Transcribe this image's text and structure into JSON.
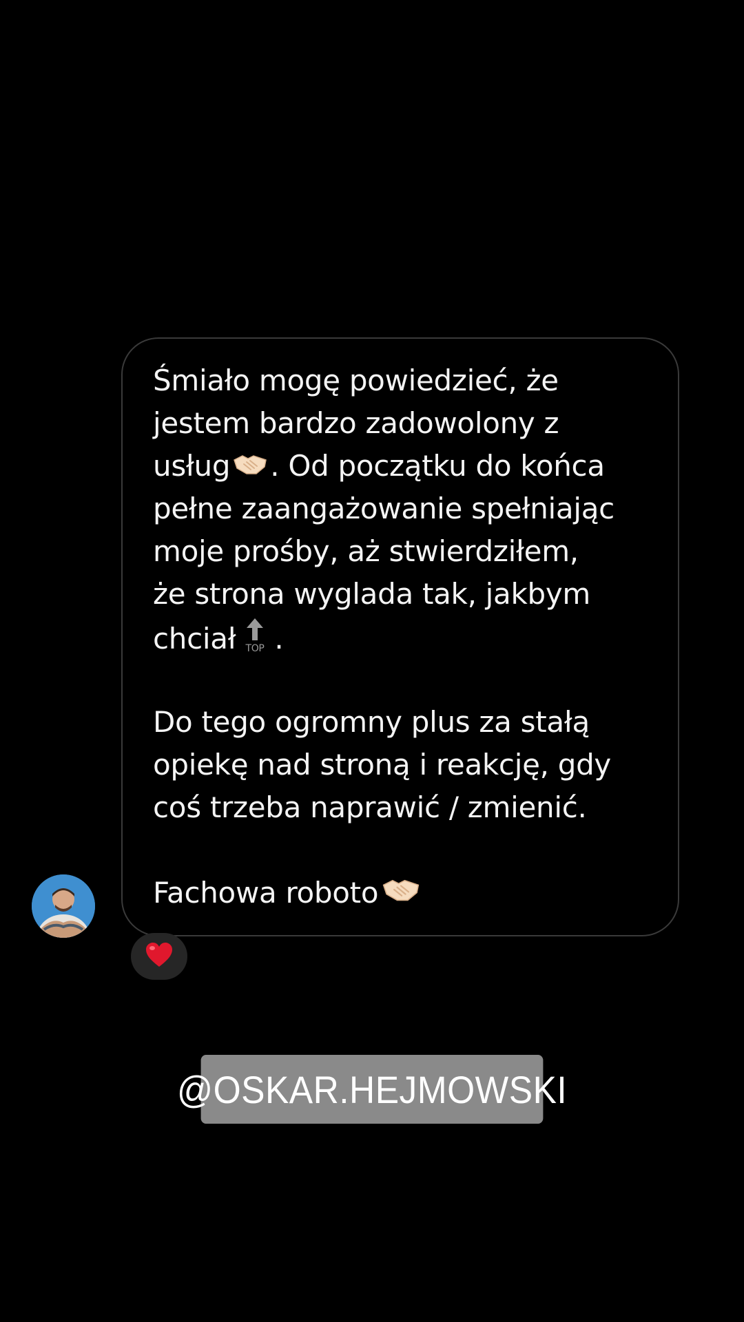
{
  "message": {
    "lines": [
      "Śmiało mogę powiedzieć, że",
      "jestem bardzo zadowolony z",
      "usług",
      ". Od początku do końca",
      "pełne zaangażowanie spełniając",
      "moje prośby, aż stwierdziłem,",
      "że strona wyglada tak, jakbym",
      "chciał",
      ".",
      "Do tego ogromny plus za stałą",
      "opiekę nad stroną i reakcję, gdy",
      "coś trzeba naprawić / zmienić.",
      "Fachowa roboto"
    ],
    "top_icon_label": "TOP"
  },
  "reaction": {
    "icon": "heart-icon"
  },
  "mention": {
    "label": "@OSKAR.HEJMOWSKI"
  },
  "colors": {
    "background": "#000000",
    "bubble_border": "#3a3a3a",
    "mention_bg": "#8a8a8a",
    "heart": "#e0182d"
  }
}
